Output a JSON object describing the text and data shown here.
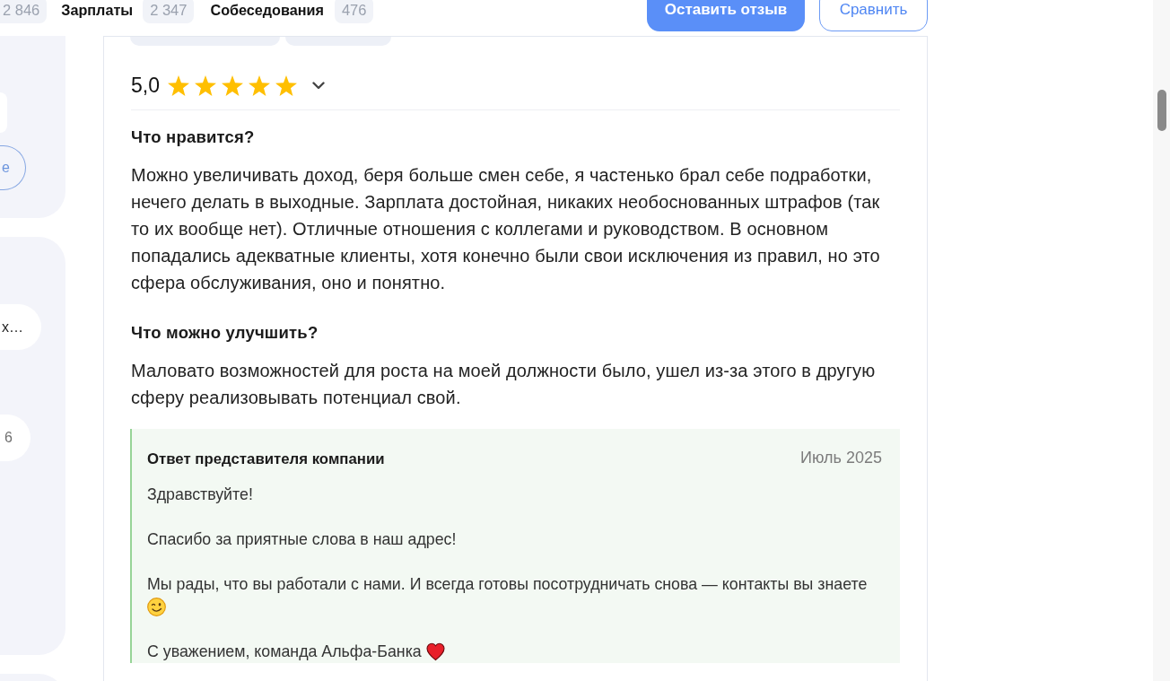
{
  "header": {
    "tabs": [
      {
        "count": "2 846"
      },
      {
        "label": "Зарплаты",
        "count": "2 347"
      },
      {
        "label": "Собеседования",
        "count": "476"
      }
    ],
    "buttons": [
      {
        "label": "Оставить отзыв",
        "kind": "primary"
      },
      {
        "label": "Сравнить",
        "kind": "outline"
      }
    ]
  },
  "sidebar": {
    "cards": [
      {
        "items": [
          {
            "kind": "chip"
          },
          {
            "kind": "outline",
            "label": "е"
          }
        ]
      },
      {
        "items": [
          {
            "kind": "chip",
            "label": "х…"
          },
          {
            "kind": "count",
            "label": "6"
          }
        ]
      }
    ]
  },
  "review": {
    "rating": "5,0",
    "stars": 5,
    "sections": [
      {
        "heading": "Что нравится?",
        "text": "Можно увеличивать доход, беря больше смен себе, я частенько брал себе подработки, нечего делать в выходные. Зарплата достойная, никаких необоснованных штрафов (так то их вообще нет). Отличные отношения с коллегами и руководством. В основном попадались адекватные клиенты, хотя конечно были свои исключения из правил, но это сфера обслуживания, оно и понятно."
      },
      {
        "heading": "Что можно улучшить?",
        "text": "Маловато возможностей для роста на моей должности было, ушел из-за этого в другую сферу реализовывать потенциал свой."
      }
    ],
    "company_response": {
      "title": "Ответ представителя компании",
      "date": "Июль 2025",
      "paragraphs": [
        "Здравствуйте!",
        "Спасибо за приятные слова в наш адрес!",
        "Мы рады, что вы работали с нами. И всегда готовы посотрудничать снова — контакты вы знаете",
        "С уважением, команда Альфа-Банка"
      ]
    }
  }
}
